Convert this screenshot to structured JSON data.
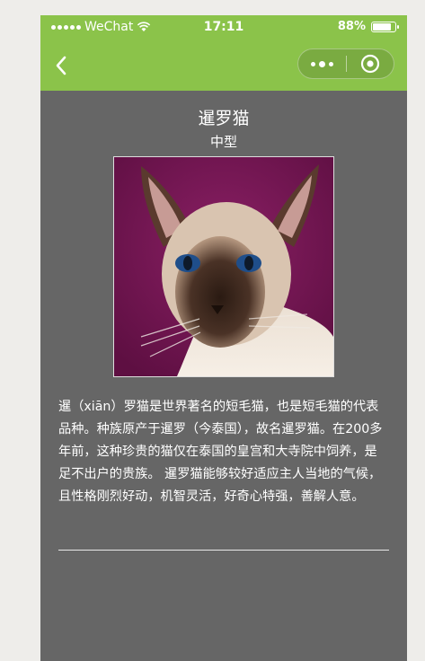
{
  "status_bar": {
    "carrier": "WeChat",
    "time": "17:11",
    "battery": "88%",
    "battery_level": 0.88
  },
  "nav": {
    "back_icon": "chevron-left-icon",
    "more_icon": "more-dots-icon",
    "close_icon": "target-circle-icon"
  },
  "breed": {
    "name": "暹罗猫",
    "size": "中型",
    "description": "暹（xiān）罗猫是世界著名的短毛猫，也是短毛猫的代表品种。种族原产于暹罗（今泰国），故名暹罗猫。在200多年前，这种珍贵的猫仅在泰国的皇宫和大寺院中饲养，是足不出户的贵族。 暹罗猫能够较好适应主人当地的气候，且性格刚烈好动，机智灵活，好奇心特强，善解人意。"
  },
  "colors": {
    "nav_green": "#8bc34a",
    "page_bg": "#666666",
    "outer_bg": "#eeedea"
  }
}
